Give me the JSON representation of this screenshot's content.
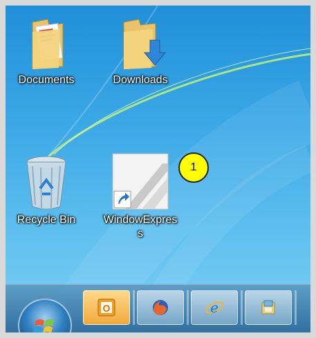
{
  "desktop": {
    "icons": [
      {
        "label": "Documents",
        "icon": "documents-folder-icon"
      },
      {
        "label": "Downloads",
        "icon": "downloads-folder-icon"
      },
      {
        "label": "Recycle Bin",
        "icon": "recycle-bin-icon"
      },
      {
        "label": "WindowExpress",
        "icon": "windowexpress-shortcut-icon"
      }
    ]
  },
  "annotation": {
    "number": "1"
  },
  "taskbar": {
    "start_button": "windows-start-orb-icon",
    "pinned": [
      {
        "icon": "outlook-icon",
        "active": true
      },
      {
        "icon": "firefox-icon",
        "active": false
      },
      {
        "icon": "internet-explorer-icon",
        "active": false
      },
      {
        "icon": "file-explorer-icon",
        "active": false
      }
    ]
  },
  "colors": {
    "desktop_top": "#1f8fd8",
    "desktop_bottom": "#7fd0f3",
    "badge": "#ffff00",
    "active_task": "#f2a93b"
  }
}
